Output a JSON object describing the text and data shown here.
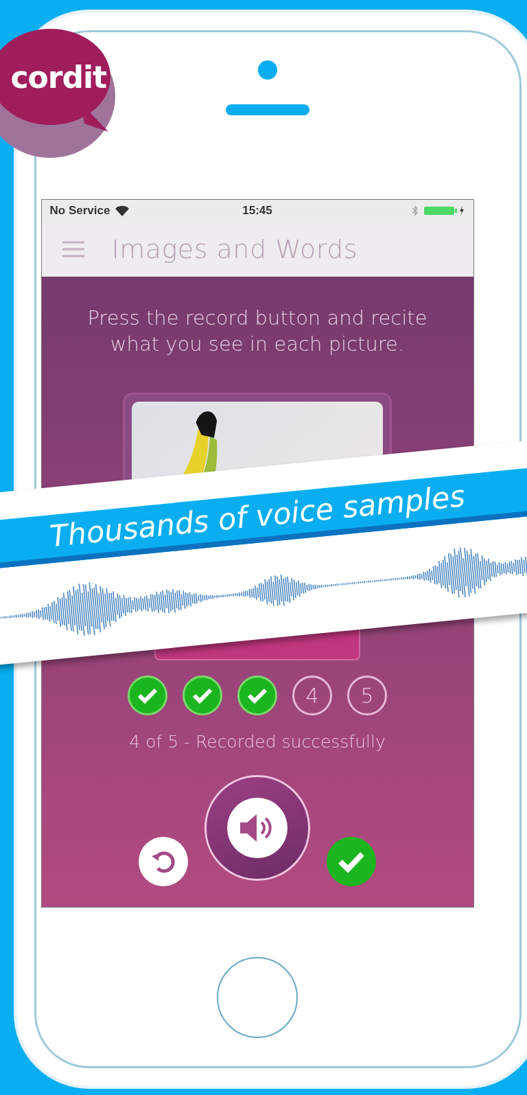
{
  "logo": {
    "text": "cordit"
  },
  "status_bar": {
    "carrier": "No Service",
    "time": "15:45"
  },
  "nav": {
    "title": "Images and Words"
  },
  "instructions": "Press the record button and recite what you see in each picture.",
  "progress": [
    {
      "done": true
    },
    {
      "done": true
    },
    {
      "done": true
    },
    {
      "done": false,
      "label": "4"
    },
    {
      "done": false,
      "label": "5"
    }
  ],
  "status_text": "4 of 5 - Recorded successfully",
  "banner": {
    "text": "Thousands of voice samples"
  }
}
